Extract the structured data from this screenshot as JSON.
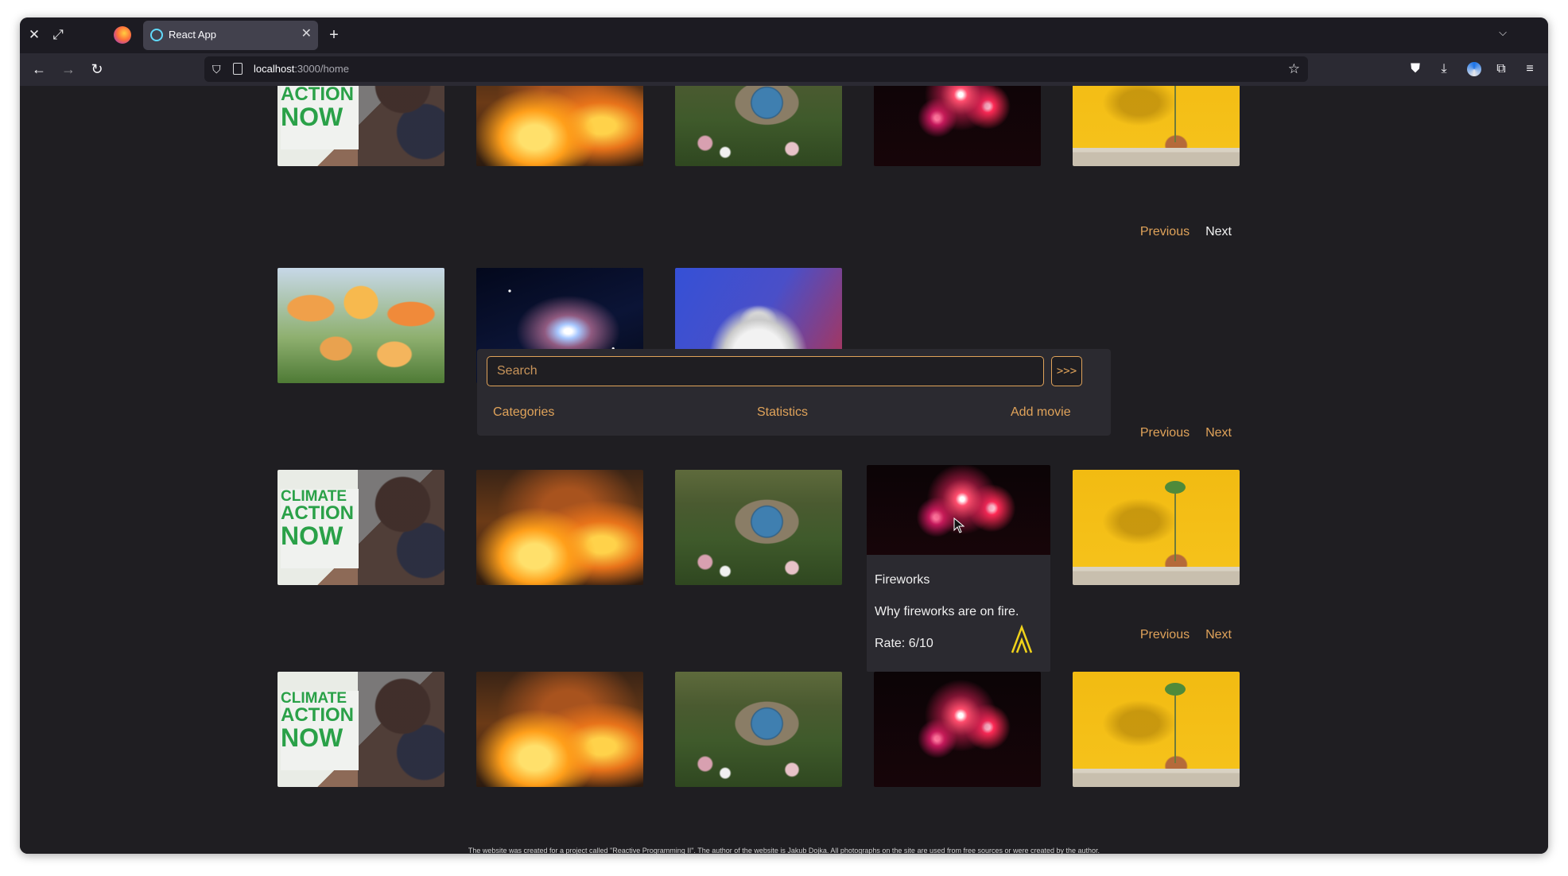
{
  "browser": {
    "tab_title": "React App",
    "url_host": "localhost",
    "url_path": ":3000/home"
  },
  "rows": [
    {
      "pager": {
        "previous": "Previous",
        "next": "Next"
      }
    },
    {
      "pager": {
        "previous": "Previous",
        "next": "Next"
      }
    },
    {
      "pager": {
        "previous": "Previous",
        "next": "Next"
      }
    }
  ],
  "search": {
    "placeholder": "Search",
    "go_label": ">>>",
    "links": [
      "Categories",
      "Statistics",
      "Add movie"
    ]
  },
  "hover_card": {
    "title": "Fireworks",
    "description": "Why fireworks are on fire.",
    "rate": "Rate: 6/10"
  },
  "climate_sign": [
    "CLIMATE",
    "ACTION",
    "NOW"
  ],
  "footer": "The website was created for a project called \"Reactive Programming II\". The author of the website is Jakub Dojka. All photographs on the site are used from free sources or were created by the author.",
  "accent_color": "#e0a35a",
  "icons": [
    "close-icon",
    "fullscreen-icon",
    "firefox-logo-icon",
    "react-icon",
    "tab-close-icon",
    "new-tab-icon",
    "tab-list-icon",
    "back-icon",
    "forward-icon",
    "reload-icon",
    "shield-icon",
    "page-icon",
    "star-icon",
    "pocket-icon",
    "download-icon",
    "account-icon",
    "extensions-icon",
    "menu-icon",
    "arrow-up-icon"
  ]
}
